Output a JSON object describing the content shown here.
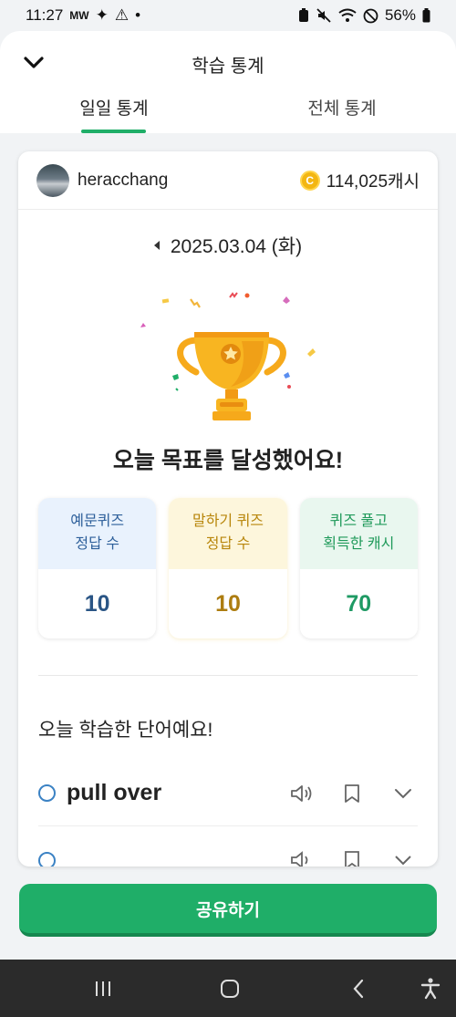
{
  "status_bar": {
    "time": "11:27",
    "left_icons": [
      "mw-icon",
      "sparkle-icon",
      "alert-icon",
      "dot-icon"
    ],
    "battery": "56%"
  },
  "header": {
    "title": "학습 통계",
    "tabs": [
      {
        "label": "일일 통계",
        "active": true
      },
      {
        "label": "전체 통계",
        "active": false
      }
    ]
  },
  "user": {
    "name": "heracchang",
    "cash": "114,025캐시"
  },
  "date": "2025.03.04 (화)",
  "goal_message": "오늘 목표를 달성했어요!",
  "stats": [
    {
      "label_line1": "예문퀴즈",
      "label_line2": "정답 수",
      "value": "10",
      "color": "#2a5585"
    },
    {
      "label_line1": "말하기 퀴즈",
      "label_line2": "정답 수",
      "value": "10",
      "color": "#ad7d10"
    },
    {
      "label_line1": "퀴즈 풀고",
      "label_line2": "획득한 캐시",
      "value": "70",
      "color": "#1f9a64"
    }
  ],
  "words_section_title": "오늘 학습한 단어예요!",
  "words": [
    "pull over",
    ""
  ],
  "share_button": "공유하기",
  "colors": {
    "accent": "#1fae68",
    "coin": "#f3b612",
    "trophy": "#f6a91b"
  }
}
